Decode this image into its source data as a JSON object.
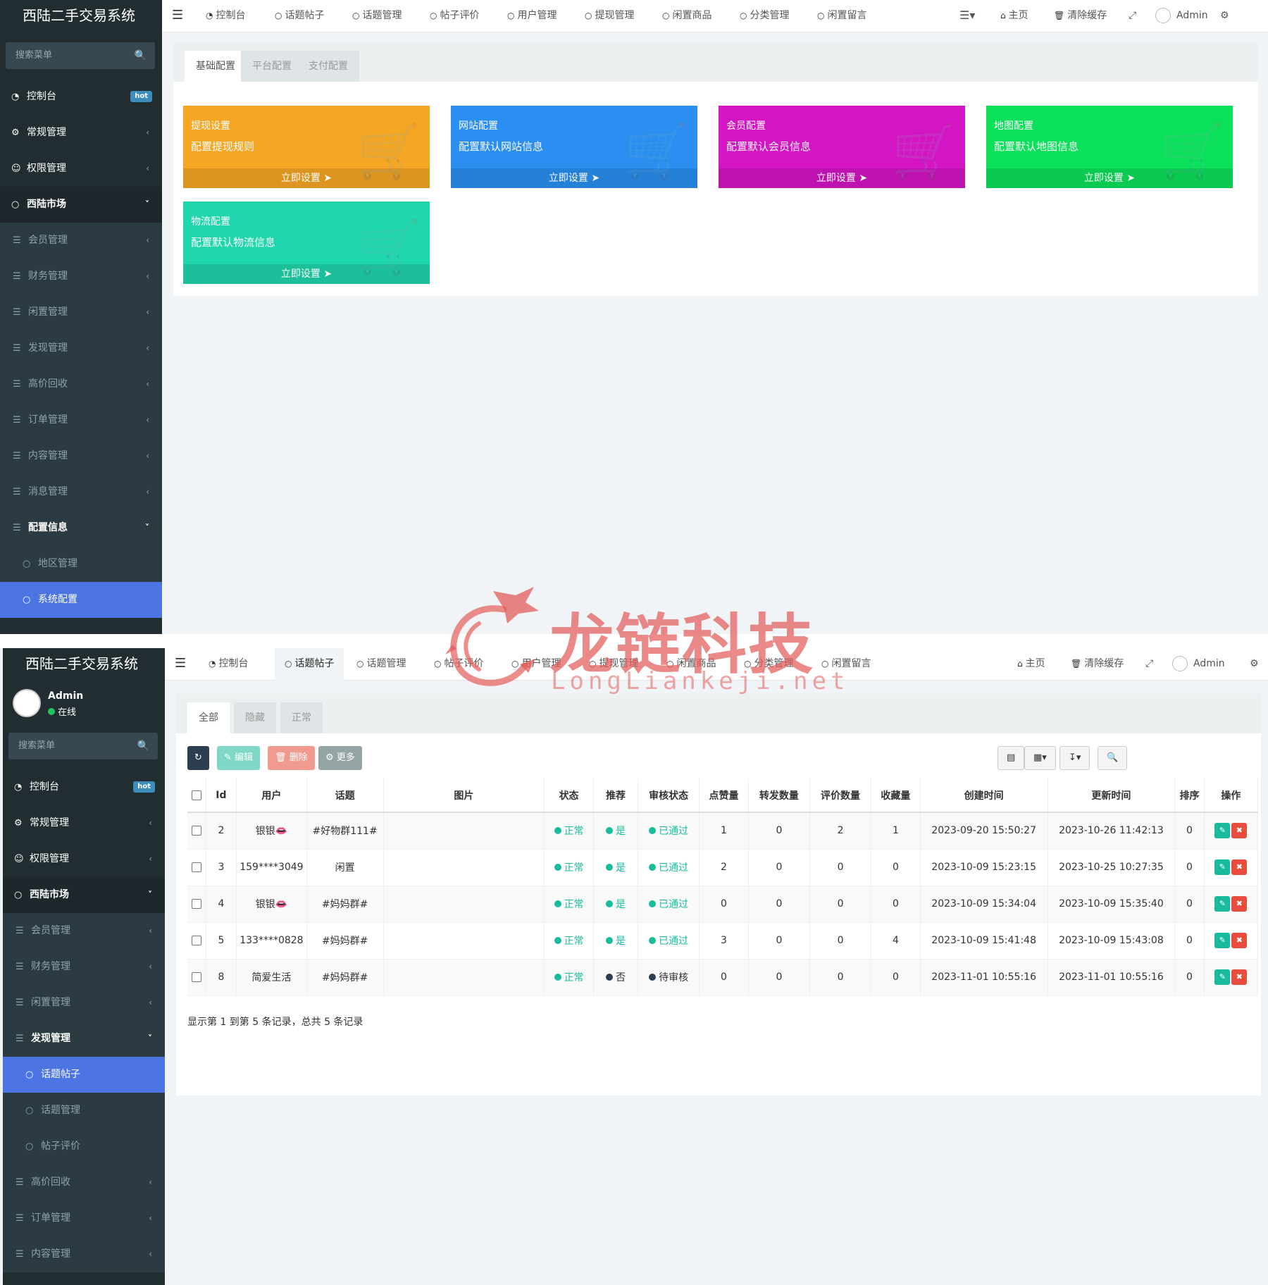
{
  "app": {
    "title": "西陆二手交易系统"
  },
  "user": {
    "name": "Admin",
    "status": "在线"
  },
  "sidebar": {
    "search_placeholder": "搜索菜单",
    "hot_badge": "hot",
    "panel1_items": [
      {
        "label": "控制台",
        "icon": "dashboard-icon",
        "kind": "top",
        "badge": "hot"
      },
      {
        "label": "常规管理",
        "icon": "cogs-icon",
        "kind": "top"
      },
      {
        "label": "权限管理",
        "icon": "group-icon",
        "kind": "top"
      },
      {
        "label": "西陆市场",
        "icon": "circle-icon",
        "kind": "open"
      },
      {
        "label": "会员管理",
        "icon": "list-icon",
        "kind": "sub"
      },
      {
        "label": "财务管理",
        "icon": "list-icon",
        "kind": "sub"
      },
      {
        "label": "闲置管理",
        "icon": "list-icon",
        "kind": "sub"
      },
      {
        "label": "发现管理",
        "icon": "list-icon",
        "kind": "sub"
      },
      {
        "label": "高价回收",
        "icon": "list-icon",
        "kind": "sub"
      },
      {
        "label": "订单管理",
        "icon": "list-icon",
        "kind": "sub"
      },
      {
        "label": "内容管理",
        "icon": "list-icon",
        "kind": "sub"
      },
      {
        "label": "消息管理",
        "icon": "list-icon",
        "kind": "sub"
      },
      {
        "label": "配置信息",
        "icon": "list-icon",
        "kind": "subopen"
      },
      {
        "label": "地区管理",
        "icon": "circle-icon",
        "kind": "child"
      },
      {
        "label": "系统配置",
        "icon": "circle-icon",
        "kind": "active"
      }
    ],
    "panel2_items": [
      {
        "label": "控制台",
        "icon": "dashboard-icon",
        "kind": "top",
        "badge": "hot"
      },
      {
        "label": "常规管理",
        "icon": "cogs-icon",
        "kind": "top"
      },
      {
        "label": "权限管理",
        "icon": "group-icon",
        "kind": "top"
      },
      {
        "label": "西陆市场",
        "icon": "circle-icon",
        "kind": "open"
      },
      {
        "label": "会员管理",
        "icon": "list-icon",
        "kind": "sub"
      },
      {
        "label": "财务管理",
        "icon": "list-icon",
        "kind": "sub"
      },
      {
        "label": "闲置管理",
        "icon": "list-icon",
        "kind": "sub"
      },
      {
        "label": "发现管理",
        "icon": "list-icon",
        "kind": "subopen"
      },
      {
        "label": "话题帖子",
        "icon": "circle-icon",
        "kind": "active"
      },
      {
        "label": "话题管理",
        "icon": "circle-icon",
        "kind": "child"
      },
      {
        "label": "帖子评价",
        "icon": "circle-icon",
        "kind": "child"
      },
      {
        "label": "高价回收",
        "icon": "list-icon",
        "kind": "sub"
      },
      {
        "label": "订单管理",
        "icon": "list-icon",
        "kind": "sub"
      },
      {
        "label": "内容管理",
        "icon": "list-icon",
        "kind": "sub"
      }
    ]
  },
  "topnav": {
    "tabs": [
      "控制台",
      "话题帖子",
      "话题管理",
      "帖子评价",
      "用户管理",
      "提现管理",
      "闲置商品",
      "分类管理",
      "闲置留言"
    ],
    "home": "主页",
    "clear_cache": "清除缓存",
    "admin": "Admin"
  },
  "config_page": {
    "tabs": [
      "基础配置",
      "平台配置",
      "支付配置"
    ],
    "cards": [
      {
        "title": "提现设置",
        "desc": "配置提现规则",
        "action": "立即设置",
        "color": "#f5a623"
      },
      {
        "title": "网站配置",
        "desc": "配置默认网站信息",
        "action": "立即设置",
        "color": "#2a8ff0"
      },
      {
        "title": "会员配置",
        "desc": "配置默认会员信息",
        "action": "立即设置",
        "color": "#d415c4"
      },
      {
        "title": "地图配置",
        "desc": "配置默认地图信息",
        "action": "立即设置",
        "color": "#0be05a"
      },
      {
        "title": "物流配置",
        "desc": "配置默认物流信息",
        "action": "立即设置",
        "color": "#1fd6ad"
      }
    ]
  },
  "posts_page": {
    "tabs": [
      "全部",
      "隐藏",
      "正常"
    ],
    "buttons": {
      "edit": "编辑",
      "delete": "删除",
      "more": "更多"
    },
    "columns": [
      "Id",
      "用户",
      "话题",
      "图片",
      "状态",
      "推荐",
      "审核状态",
      "点赞量",
      "转发数量",
      "评价数量",
      "收藏量",
      "创建时间",
      "更新时间",
      "排序",
      "操作"
    ],
    "rows": [
      {
        "id": "2",
        "user": "银银👄",
        "topic": "#好物群111#",
        "topic_style": "dark",
        "status": "正常",
        "recommend": "是",
        "review": "已通过",
        "likes": "1",
        "shares": "0",
        "comments": "2",
        "favs": "1",
        "created": "2023-09-20 15:50:27",
        "updated": "2023-10-26 11:42:13",
        "sort": "0"
      },
      {
        "id": "3",
        "user": "159****3049",
        "topic": "闲置",
        "topic_style": "muted",
        "status": "正常",
        "recommend": "是",
        "review": "已通过",
        "likes": "2",
        "shares": "0",
        "comments": "0",
        "favs": "0",
        "created": "2023-10-09 15:23:15",
        "updated": "2023-10-25 10:27:35",
        "sort": "0"
      },
      {
        "id": "4",
        "user": "银银👄",
        "topic": "#妈妈群#",
        "topic_style": "orange",
        "status": "正常",
        "recommend": "是",
        "review": "已通过",
        "likes": "0",
        "shares": "0",
        "comments": "0",
        "favs": "0",
        "created": "2023-10-09 15:34:04",
        "updated": "2023-10-09 15:35:40",
        "sort": "0"
      },
      {
        "id": "5",
        "user": "133****0828",
        "topic": "#妈妈群#",
        "topic_style": "orange",
        "status": "正常",
        "recommend": "是",
        "review": "已通过",
        "likes": "3",
        "shares": "0",
        "comments": "0",
        "favs": "4",
        "created": "2023-10-09 15:41:48",
        "updated": "2023-10-09 15:43:08",
        "sort": "0"
      },
      {
        "id": "8",
        "user": "简爱生活",
        "topic": "#妈妈群#",
        "topic_style": "orange",
        "status": "正常",
        "recommend": "否",
        "review": "待审核",
        "likes": "0",
        "shares": "0",
        "comments": "0",
        "favs": "0",
        "created": "2023-11-01 10:55:16",
        "updated": "2023-11-01 10:55:16",
        "sort": "0"
      }
    ],
    "footer": "显示第 1 到第 5 条记录，总共 5 条记录"
  },
  "watermark": {
    "title": "龙链科技",
    "subtitle": "LongLiankeji.net"
  },
  "colors": {
    "sidebar": "#222d32",
    "active": "#4c74e3",
    "green": "#18bc9c",
    "red": "#e74c3c",
    "orange": "#f39c12"
  }
}
